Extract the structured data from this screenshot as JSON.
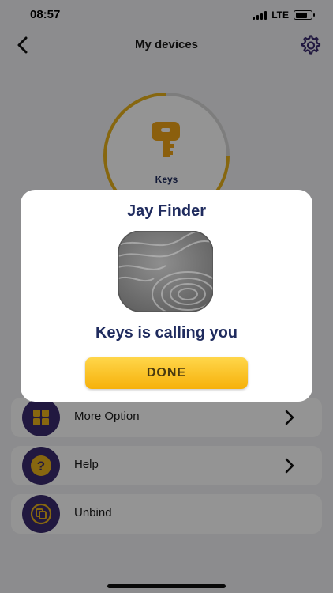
{
  "status_bar": {
    "time": "08:57",
    "network": "LTE"
  },
  "header": {
    "title": "My devices",
    "back_icon": "chevron-left-icon",
    "settings_icon": "gear-icon"
  },
  "device": {
    "name": "Keys",
    "icon": "key-icon"
  },
  "menu": [
    {
      "label": "More Option",
      "icon": "grid-icon",
      "has_chevron": true
    },
    {
      "label": "Help",
      "icon": "question-icon",
      "has_chevron": true
    },
    {
      "label": "Unbind",
      "icon": "unbind-icon",
      "has_chevron": false
    }
  ],
  "dialog": {
    "title": "Jay Finder",
    "message": "Keys is calling you",
    "button_label": "DONE",
    "image": "tracker-tag"
  },
  "colors": {
    "accent": "#f6b10a",
    "navy": "#1f2b5e",
    "icon_circle": "#3a2a6e",
    "ring": "#e8b21a"
  }
}
